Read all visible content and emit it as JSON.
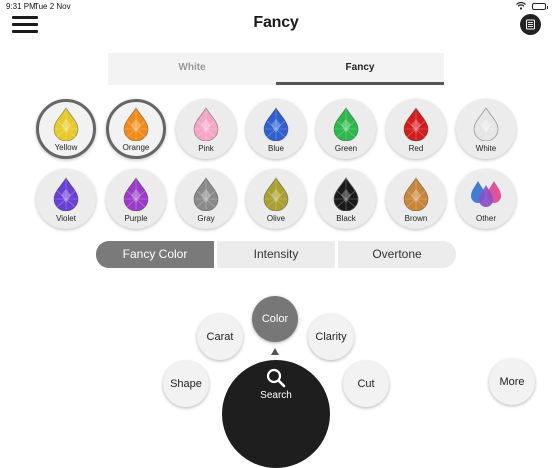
{
  "status_bar": {
    "time": "9:31 PM",
    "date": "Tue 2 Nov"
  },
  "header": {
    "title": "Fancy"
  },
  "segments": {
    "white": "White",
    "fancy": "Fancy"
  },
  "colors": [
    {
      "label": "Yellow",
      "hex": "#e8c92a",
      "selected": true
    },
    {
      "label": "Orange",
      "hex": "#f08c1a",
      "selected": true
    },
    {
      "label": "Pink",
      "hex": "#f5a6c8",
      "selected": false
    },
    {
      "label": "Blue",
      "hex": "#2f5fd0",
      "selected": false
    },
    {
      "label": "Green",
      "hex": "#2db84a",
      "selected": false
    },
    {
      "label": "Red",
      "hex": "#d41c1c",
      "selected": false
    },
    {
      "label": "White",
      "hex": "#e6e6e6",
      "selected": false
    },
    {
      "label": "Violet",
      "hex": "#6a3fd6",
      "selected": false
    },
    {
      "label": "Purple",
      "hex": "#9b3cc8",
      "selected": false
    },
    {
      "label": "Gray",
      "hex": "#8a8a8a",
      "selected": false
    },
    {
      "label": "Olive",
      "hex": "#a8a030",
      "selected": false
    },
    {
      "label": "Black",
      "hex": "#1a1a1a",
      "selected": false
    },
    {
      "label": "Brown",
      "hex": "#c7863a",
      "selected": false
    },
    {
      "label": "Other",
      "hex": "other",
      "selected": false
    }
  ],
  "sub_tabs": {
    "fancy_color": "Fancy Color",
    "intensity": "Intensity",
    "overtone": "Overtone"
  },
  "radial": {
    "color": "Color",
    "carat": "Carat",
    "clarity": "Clarity",
    "shape": "Shape",
    "cut": "Cut",
    "search": "Search",
    "more": "More"
  }
}
